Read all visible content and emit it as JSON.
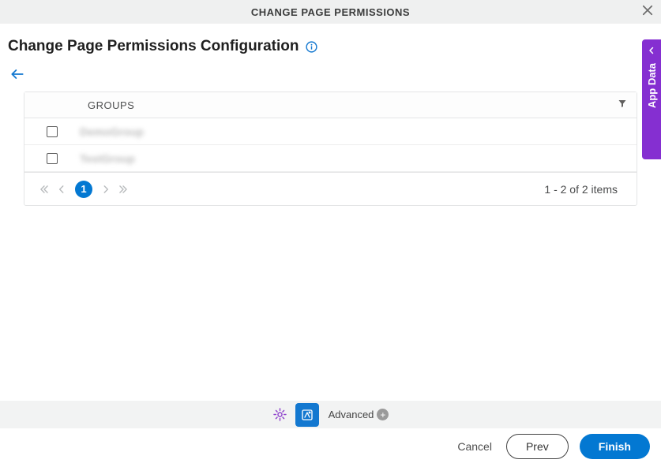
{
  "header": {
    "title": "CHANGE PAGE PERMISSIONS"
  },
  "page": {
    "title": "Change Page Permissions Configuration"
  },
  "table": {
    "column_label": "GROUPS",
    "rows": [
      {
        "name": "DemoGroup",
        "checked": false
      },
      {
        "name": "TestGroup",
        "checked": false
      }
    ]
  },
  "pagination": {
    "current_page": "1",
    "info": "1 - 2 of 2 items"
  },
  "toolbar": {
    "advanced_label": "Advanced"
  },
  "side_tab": {
    "label": "App Data"
  },
  "footer": {
    "cancel": "Cancel",
    "prev": "Prev",
    "finish": "Finish"
  }
}
